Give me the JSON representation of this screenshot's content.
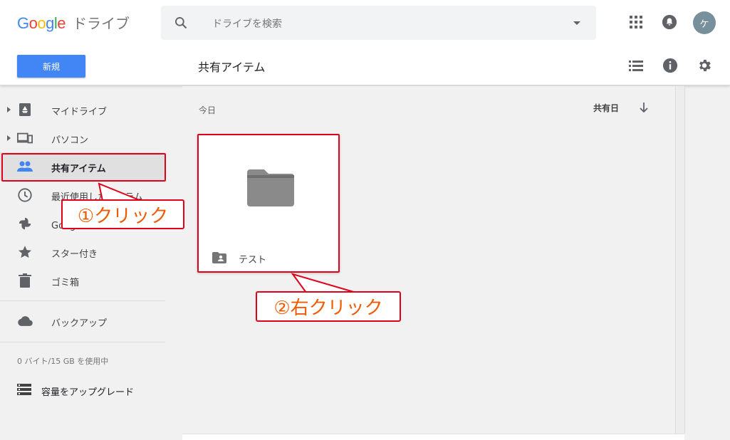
{
  "app": {
    "logo_letters": [
      {
        "char": "G",
        "color": "#4285f4"
      },
      {
        "char": "o",
        "color": "#ea4335"
      },
      {
        "char": "o",
        "color": "#fbbc05"
      },
      {
        "char": "g",
        "color": "#4285f4"
      },
      {
        "char": "l",
        "color": "#34a853"
      },
      {
        "char": "e",
        "color": "#ea4335"
      }
    ],
    "product_name": "ドライブ"
  },
  "search": {
    "placeholder": "ドライブを検索"
  },
  "header": {
    "avatar_initial": "ケ"
  },
  "toolbar": {
    "new_label": "新規",
    "page_title": "共有アイテム"
  },
  "sidebar": {
    "items": [
      {
        "label": "マイドライブ",
        "icon": "drive-icon"
      },
      {
        "label": "パソコン",
        "icon": "computer-icon"
      },
      {
        "label": "共有アイテム",
        "icon": "people-icon",
        "active": true
      },
      {
        "label": "最近使用したアイテム",
        "icon": "clock-icon"
      },
      {
        "label": "Google フォト",
        "icon": "pinwheel-icon"
      },
      {
        "label": "スター付き",
        "icon": "star-icon"
      },
      {
        "label": "ゴミ箱",
        "icon": "trash-icon"
      },
      {
        "label": "バックアップ",
        "icon": "cloud-icon"
      }
    ],
    "storage": "0 バイト/15 GB を使用中",
    "upgrade_label": "容量をアップグレード"
  },
  "main": {
    "section": "今日",
    "sort_label": "共有日",
    "folder": {
      "name": "テスト"
    }
  },
  "annotations": {
    "callout1": "①クリック",
    "callout2": "②右クリック",
    "color": "#e0001a",
    "text_color": "#ee5b00"
  }
}
